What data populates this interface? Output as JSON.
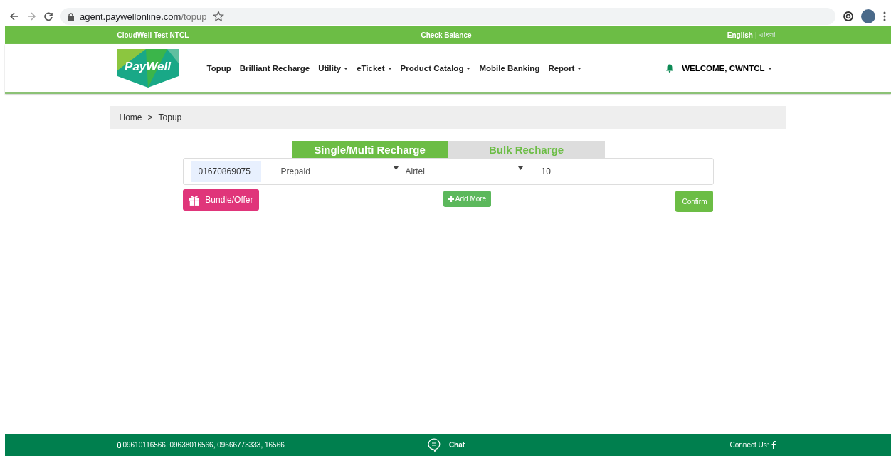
{
  "browser": {
    "url_host": "agent.paywellonline.com",
    "url_path": "/topup"
  },
  "top_bar": {
    "account": "CloudWell Test NTCL",
    "check_balance": "Check Balance",
    "separator": "|",
    "languages": [
      {
        "label": "English",
        "selected": true
      },
      {
        "label": "বাংলা",
        "selected": false
      }
    ]
  },
  "header": {
    "logo": "PayWell",
    "user": "WELCOME, CWNTCL",
    "nav": [
      {
        "label": "Topup",
        "dropdown": false
      },
      {
        "label": "Brilliant Recharge",
        "dropdown": false
      },
      {
        "label": "Utility",
        "dropdown": true
      },
      {
        "label": "eTicket",
        "dropdown": true
      },
      {
        "label": "Product Catalog",
        "dropdown": true
      },
      {
        "label": "Mobile Banking",
        "dropdown": false
      },
      {
        "label": "Report",
        "dropdown": true
      }
    ]
  },
  "breadcrumb": {
    "separator": ">",
    "items": [
      "Home",
      "Topup"
    ]
  },
  "tabs": [
    {
      "label": "Single/Multi Recharge",
      "selected": true
    },
    {
      "label": "Bulk Recharge",
      "selected": false
    }
  ],
  "recharge_row": {
    "number": "01670869075",
    "type": "Prepaid",
    "operator": "Airtel",
    "amount": "10"
  },
  "buttons": {
    "bundle": "Bundle/Offer",
    "add_more": "Add More",
    "confirm": "Confirm"
  },
  "footer": {
    "phones": "09610116566, 09638016566, 09666773333, 16566",
    "chat": "Chat",
    "connect": "Connect Us:"
  }
}
